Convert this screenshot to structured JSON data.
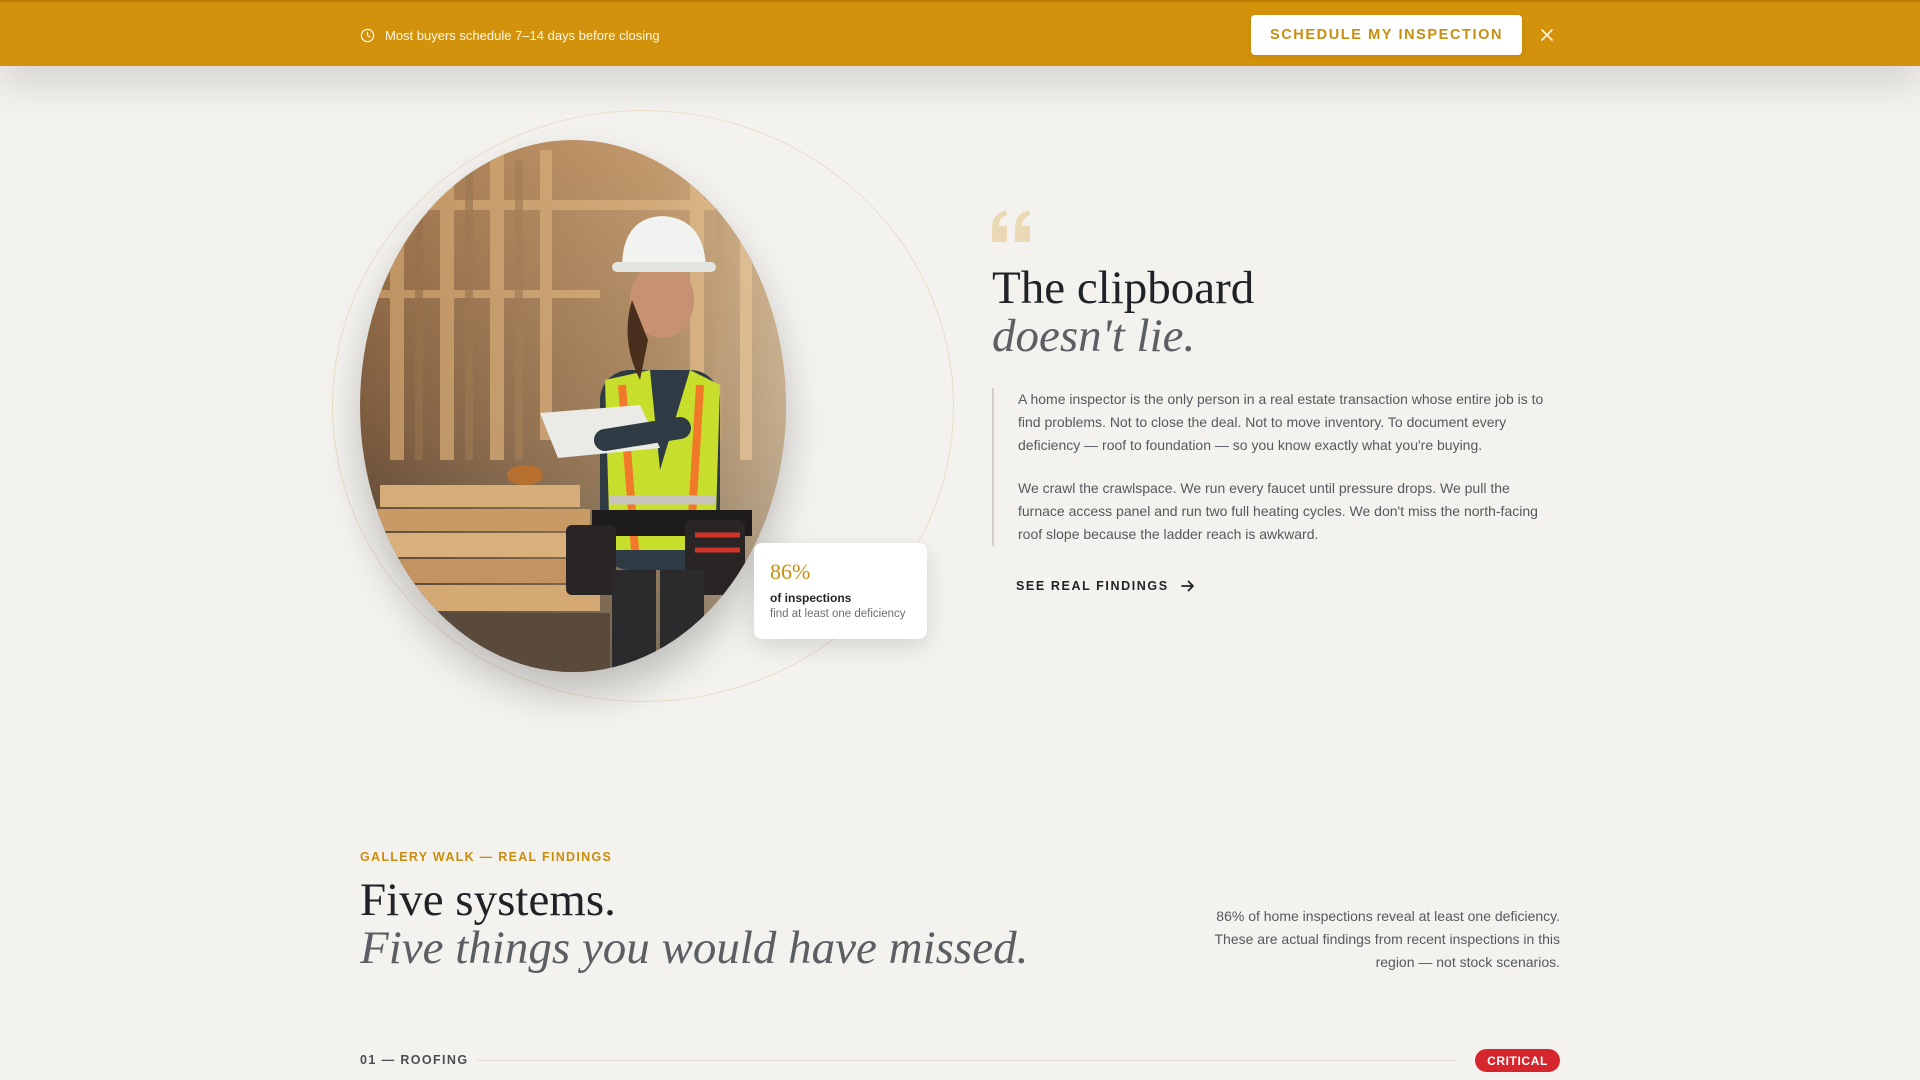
{
  "banner": {
    "message": "Most buyers schedule 7–14 days before closing",
    "cta_label": "SCHEDULE MY INSPECTION",
    "background_color": "#d3920c"
  },
  "hero": {
    "image_description_icon": "inspector-photo",
    "stat": {
      "value": "86%",
      "label": "of inspections",
      "sublabel": "find at least one deficiency"
    }
  },
  "intro": {
    "title_line1": "The clipboard",
    "title_line2": "doesn't lie.",
    "paragraphs": [
      "A home inspector is the only person in a real estate transaction whose entire job is to find problems. Not to close the deal. Not to move inventory. To document every deficiency — roof to foundation — so you know exactly what you're buying.",
      "We crawl the crawlspace. We run every faucet until pressure drops. We pull the furnace access panel and run two full heating cycles. We don't miss the north-facing roof slope because the ladder reach is awkward."
    ],
    "link_label": "SEE REAL FINDINGS"
  },
  "gallery": {
    "eyebrow": "GALLERY WALK — REAL FINDINGS",
    "title_line1": "Five systems.",
    "title_line2": "Five things you would have missed.",
    "description": "86% of home inspections reveal at least one deficiency. These are actual findings from recent inspections in this region — not stock scenarios.",
    "rows": [
      {
        "label": "01 — ROOFING",
        "badge": "CRITICAL",
        "badge_color": "#d4262c"
      }
    ]
  },
  "accent_color": "#c88d0f"
}
